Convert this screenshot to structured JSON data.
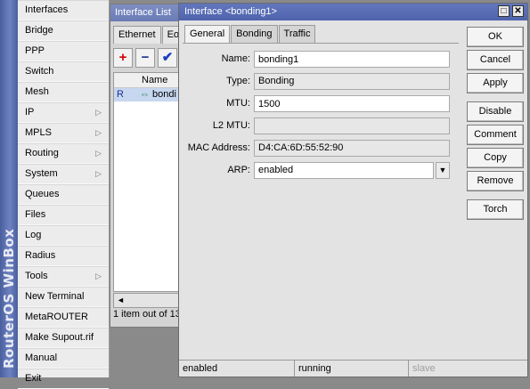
{
  "brand": {
    "text": "RouterOS WinBox"
  },
  "side_menu": {
    "items": [
      {
        "label": "Interfaces",
        "submenu": false
      },
      {
        "label": "Bridge",
        "submenu": false
      },
      {
        "label": "PPP",
        "submenu": false
      },
      {
        "label": "Switch",
        "submenu": false
      },
      {
        "label": "Mesh",
        "submenu": false
      },
      {
        "label": "IP",
        "submenu": true
      },
      {
        "label": "MPLS",
        "submenu": true
      },
      {
        "label": "Routing",
        "submenu": true
      },
      {
        "label": "System",
        "submenu": true
      },
      {
        "label": "Queues",
        "submenu": false
      },
      {
        "label": "Files",
        "submenu": false
      },
      {
        "label": "Log",
        "submenu": false
      },
      {
        "label": "Radius",
        "submenu": false
      },
      {
        "label": "Tools",
        "submenu": true
      },
      {
        "label": "New Terminal",
        "submenu": false
      },
      {
        "label": "MetaROUTER",
        "submenu": false
      },
      {
        "label": "Make Supout.rif",
        "submenu": false
      },
      {
        "label": "Manual",
        "submenu": false
      },
      {
        "label": "Exit",
        "submenu": false
      }
    ],
    "submenu_glyph": "▷"
  },
  "interface_list": {
    "title": "Interface List",
    "tabs": [
      "Ethernet",
      "Eo"
    ],
    "toolbar": {
      "add": "+",
      "remove": "−",
      "enable": "✔"
    },
    "columns": {
      "flag": "",
      "name": "Name"
    },
    "rows": [
      {
        "flag": "R",
        "name": "bondi"
      }
    ],
    "scroll_left": "◄",
    "status": "1 item out of 13"
  },
  "dialog": {
    "title": "Interface <bonding1>",
    "tabs": [
      "General",
      "Bonding",
      "Traffic"
    ],
    "active_tab": "General",
    "fields": {
      "name": {
        "label": "Name:",
        "value": "bonding1"
      },
      "type": {
        "label": "Type:",
        "value": "Bonding"
      },
      "mtu": {
        "label": "MTU:",
        "value": "1500"
      },
      "l2mtu": {
        "label": "L2 MTU:",
        "value": ""
      },
      "mac": {
        "label": "MAC Address:",
        "value": "D4:CA:6D:55:52:90"
      },
      "arp": {
        "label": "ARP:",
        "value": "enabled",
        "dropdown_glyph": "▼"
      }
    },
    "buttons": {
      "ok": "OK",
      "cancel": "Cancel",
      "apply": "Apply",
      "disable": "Disable",
      "comment": "Comment",
      "copy": "Copy",
      "remove": "Remove",
      "torch": "Torch"
    },
    "window_controls": {
      "maximize": "□",
      "close": "✕"
    },
    "status": {
      "state": "enabled",
      "link": "running",
      "role": "slave"
    }
  },
  "colors": {
    "title_bar": "#4e63ad",
    "brand_strip": "#4a5f9e",
    "selection": "#c7d7f0",
    "add_icon": "#d00000",
    "remove_icon": "#1a2f8f",
    "enable_icon": "#1a3fbf"
  }
}
